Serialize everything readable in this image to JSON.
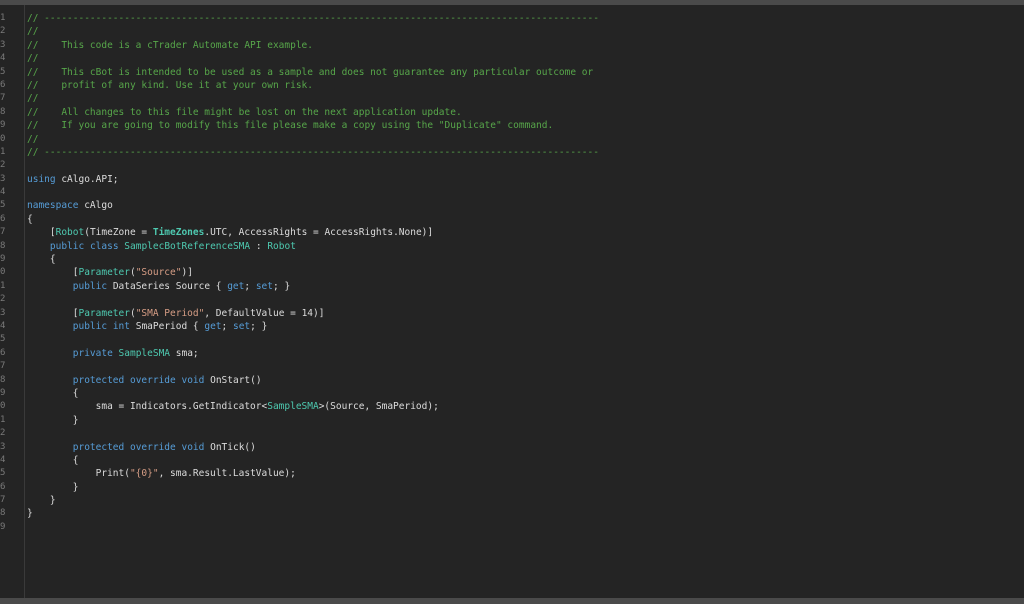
{
  "editor": {
    "line_numbers": [
      "1",
      "2",
      "3",
      "4",
      "5",
      "6",
      "7",
      "8",
      "9",
      "0",
      "1",
      "2",
      "3",
      "4",
      "5",
      "6",
      "7",
      "8",
      "9",
      "0",
      "1",
      "2",
      "3",
      "4",
      "5",
      "6",
      "7",
      "8",
      "9",
      "0",
      "1",
      "2",
      "3",
      "4",
      "5",
      "6",
      "7",
      "8",
      "9"
    ],
    "lines": [
      [
        {
          "t": "// -------------------------------------------------------------------------------------------------",
          "c": "comment"
        }
      ],
      [
        {
          "t": "//",
          "c": "comment"
        }
      ],
      [
        {
          "t": "//    This code is a cTrader Automate API example.",
          "c": "comment"
        }
      ],
      [
        {
          "t": "//",
          "c": "comment"
        }
      ],
      [
        {
          "t": "//    This cBot is intended to be used as a sample and does not guarantee any particular outcome or",
          "c": "comment"
        }
      ],
      [
        {
          "t": "//    profit of any kind. Use it at your own risk.",
          "c": "comment"
        }
      ],
      [
        {
          "t": "//",
          "c": "comment"
        }
      ],
      [
        {
          "t": "//    All changes to this file might be lost on the next application update.",
          "c": "comment"
        }
      ],
      [
        {
          "t": "//    If you are going to modify this file please make a copy using the \"Duplicate\" command.",
          "c": "comment"
        }
      ],
      [
        {
          "t": "//",
          "c": "comment"
        }
      ],
      [
        {
          "t": "// -------------------------------------------------------------------------------------------------",
          "c": "comment"
        }
      ],
      [],
      [
        {
          "t": "using",
          "c": "keyword"
        },
        {
          "t": " cAlgo.API;",
          "c": "plain"
        }
      ],
      [],
      [
        {
          "t": "namespace",
          "c": "keyword"
        },
        {
          "t": " cAlgo",
          "c": "plain"
        }
      ],
      [
        {
          "t": "{",
          "c": "plain"
        }
      ],
      [
        {
          "t": "    [",
          "c": "plain"
        },
        {
          "t": "Robot",
          "c": "type"
        },
        {
          "t": "(TimeZone = ",
          "c": "plain"
        },
        {
          "t": "TimeZones",
          "c": "bold"
        },
        {
          "t": ".UTC, AccessRights = AccessRights.None)]",
          "c": "plain"
        }
      ],
      [
        {
          "t": "    ",
          "c": "plain"
        },
        {
          "t": "public",
          "c": "keyword"
        },
        {
          "t": " ",
          "c": "plain"
        },
        {
          "t": "class",
          "c": "keyword"
        },
        {
          "t": " ",
          "c": "plain"
        },
        {
          "t": "SamplecBotReferenceSMA",
          "c": "type"
        },
        {
          "t": " : ",
          "c": "plain"
        },
        {
          "t": "Robot",
          "c": "type"
        }
      ],
      [
        {
          "t": "    {",
          "c": "plain"
        }
      ],
      [
        {
          "t": "        [",
          "c": "plain"
        },
        {
          "t": "Parameter",
          "c": "type"
        },
        {
          "t": "(",
          "c": "plain"
        },
        {
          "t": "\"Source\"",
          "c": "string"
        },
        {
          "t": ")]",
          "c": "plain"
        }
      ],
      [
        {
          "t": "        ",
          "c": "plain"
        },
        {
          "t": "public",
          "c": "keyword"
        },
        {
          "t": " DataSeries Source { ",
          "c": "plain"
        },
        {
          "t": "get",
          "c": "keyword"
        },
        {
          "t": "; ",
          "c": "plain"
        },
        {
          "t": "set",
          "c": "keyword"
        },
        {
          "t": "; }",
          "c": "plain"
        }
      ],
      [],
      [
        {
          "t": "        [",
          "c": "plain"
        },
        {
          "t": "Parameter",
          "c": "type"
        },
        {
          "t": "(",
          "c": "plain"
        },
        {
          "t": "\"SMA Period\"",
          "c": "string"
        },
        {
          "t": ", DefaultValue = 14)]",
          "c": "plain"
        }
      ],
      [
        {
          "t": "        ",
          "c": "plain"
        },
        {
          "t": "public",
          "c": "keyword"
        },
        {
          "t": " ",
          "c": "plain"
        },
        {
          "t": "int",
          "c": "keyword"
        },
        {
          "t": " SmaPeriod { ",
          "c": "plain"
        },
        {
          "t": "get",
          "c": "keyword"
        },
        {
          "t": "; ",
          "c": "plain"
        },
        {
          "t": "set",
          "c": "keyword"
        },
        {
          "t": "; }",
          "c": "plain"
        }
      ],
      [],
      [
        {
          "t": "        ",
          "c": "plain"
        },
        {
          "t": "private",
          "c": "keyword"
        },
        {
          "t": " ",
          "c": "plain"
        },
        {
          "t": "SampleSMA",
          "c": "type"
        },
        {
          "t": " sma;",
          "c": "plain"
        }
      ],
      [],
      [
        {
          "t": "        ",
          "c": "plain"
        },
        {
          "t": "protected",
          "c": "keyword"
        },
        {
          "t": " ",
          "c": "plain"
        },
        {
          "t": "override",
          "c": "keyword"
        },
        {
          "t": " ",
          "c": "plain"
        },
        {
          "t": "void",
          "c": "keyword"
        },
        {
          "t": " OnStart()",
          "c": "plain"
        }
      ],
      [
        {
          "t": "        {",
          "c": "plain"
        }
      ],
      [
        {
          "t": "            sma = Indicators.GetIndicator<",
          "c": "plain"
        },
        {
          "t": "SampleSMA",
          "c": "type"
        },
        {
          "t": ">(Source, SmaPeriod);",
          "c": "plain"
        }
      ],
      [
        {
          "t": "        }",
          "c": "plain"
        }
      ],
      [],
      [
        {
          "t": "        ",
          "c": "plain"
        },
        {
          "t": "protected",
          "c": "keyword"
        },
        {
          "t": " ",
          "c": "plain"
        },
        {
          "t": "override",
          "c": "keyword"
        },
        {
          "t": " ",
          "c": "plain"
        },
        {
          "t": "void",
          "c": "keyword"
        },
        {
          "t": " OnTick()",
          "c": "plain"
        }
      ],
      [
        {
          "t": "        {",
          "c": "plain"
        }
      ],
      [
        {
          "t": "            Print(",
          "c": "plain"
        },
        {
          "t": "\"{0}\"",
          "c": "string"
        },
        {
          "t": ", sma.Result.LastValue);",
          "c": "plain"
        }
      ],
      [
        {
          "t": "        }",
          "c": "plain"
        }
      ],
      [
        {
          "t": "    }",
          "c": "plain"
        }
      ],
      [
        {
          "t": "}",
          "c": "plain"
        }
      ],
      []
    ]
  }
}
